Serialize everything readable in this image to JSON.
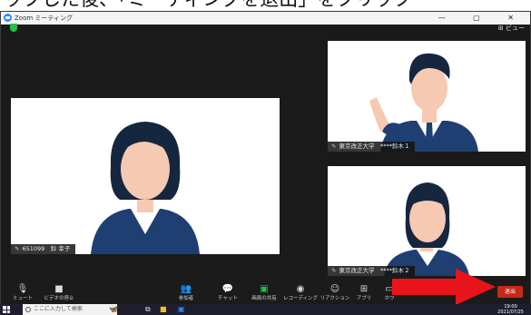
{
  "caption": "ックした後、「ミーティングを退出」をクリック",
  "window": {
    "title": "Zoom ミーティング",
    "controls": "— ▢ ✕",
    "view_label": "⊞ ビュー"
  },
  "participants": {
    "main": "651099　鈴 幸子",
    "right_top": "東京改正大学　****鈴木１",
    "right_bottom": "東京改正大学　****鈴木２"
  },
  "toolbar": {
    "items": [
      {
        "icon": "mic-icon",
        "label": "ミュート"
      },
      {
        "icon": "video-icon",
        "label": "ビデオの停止"
      },
      {
        "icon": "participants-icon",
        "label": "参加者"
      },
      {
        "icon": "chat-icon",
        "label": "チャット"
      },
      {
        "icon": "share-icon",
        "label": "画面の共有"
      },
      {
        "icon": "record-icon",
        "label": "レコーディング"
      },
      {
        "icon": "reaction-icon",
        "label": "リアクション"
      },
      {
        "icon": "apps-icon",
        "label": "アプリ"
      },
      {
        "icon": "whiteboard-icon",
        "label": "ホワ"
      }
    ],
    "end_label": "退出",
    "participant_count": "2"
  },
  "taskbar": {
    "search_placeholder": "ここに入力して検索",
    "time": "19:00",
    "date": "2021/07/25"
  },
  "colors": {
    "accent_green": "#1ec746",
    "end_red": "#c6281a",
    "arrow_red": "#e8141a",
    "suit_navy": "#1f3f73",
    "skin": "#f6c9b2",
    "hair": "#15263f"
  }
}
